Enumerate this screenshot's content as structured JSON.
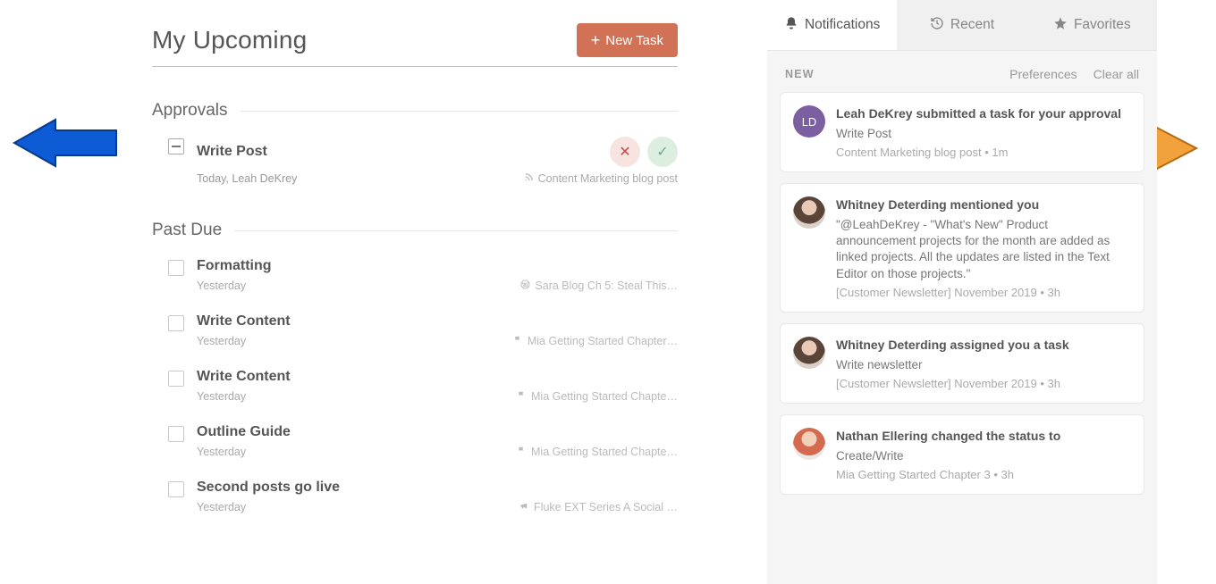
{
  "header": {
    "title": "My Upcoming",
    "newTaskLabel": "New Task"
  },
  "sections": {
    "approvals": {
      "title": "Approvals",
      "item": {
        "title": "Write Post",
        "meta": "Today,  Leah DeKrey",
        "ref": "Content Marketing blog post"
      }
    },
    "pastDue": {
      "title": "Past Due",
      "items": [
        {
          "title": "Formatting",
          "meta": "Yesterday",
          "icon": "wordpress",
          "ref": "Sara Blog Ch 5: Steal This…"
        },
        {
          "title": "Write Content",
          "meta": "Yesterday",
          "icon": "flag",
          "ref": "Mia Getting Started Chapter…"
        },
        {
          "title": "Write Content",
          "meta": "Yesterday",
          "icon": "flag",
          "ref": "Mia Getting Started Chapte…"
        },
        {
          "title": "Outline Guide",
          "meta": "Yesterday",
          "icon": "flag",
          "ref": "Mia Getting Started Chapte…"
        },
        {
          "title": "Second posts go live",
          "meta": "Yesterday",
          "icon": "megaphone",
          "ref": "Fluke EXT Series A Social …"
        }
      ]
    }
  },
  "panel": {
    "tabs": {
      "notifications": "Notifications",
      "recent": "Recent",
      "favorites": "Favorites"
    },
    "toolbar": {
      "new": "NEW",
      "preferences": "Preferences",
      "clearAll": "Clear all"
    },
    "notifications": [
      {
        "avatarText": "LD",
        "avatarClass": "ld",
        "title": "Leah DeKrey submitted a task for your approval",
        "sub": "Write Post",
        "ref": "Content Marketing blog post • 1m"
      },
      {
        "avatarClass": "photo1",
        "title": "Whitney Deterding mentioned you",
        "sub": "\"@LeahDeKrey  - \"What's New\" Product announcement projects for the month are added as linked projects. All the updates are listed in the Text Editor on those projects.\"",
        "ref": "[Customer Newsletter] November 2019 • 3h"
      },
      {
        "avatarClass": "photo1",
        "title": "Whitney Deterding assigned you a task",
        "sub": "Write newsletter",
        "ref": "[Customer Newsletter] November 2019 • 3h"
      },
      {
        "avatarClass": "photo2",
        "title": "Nathan Ellering changed the status to",
        "sub": "Create/Write",
        "ref": "Mia Getting Started Chapter 3 • 3h"
      }
    ]
  }
}
